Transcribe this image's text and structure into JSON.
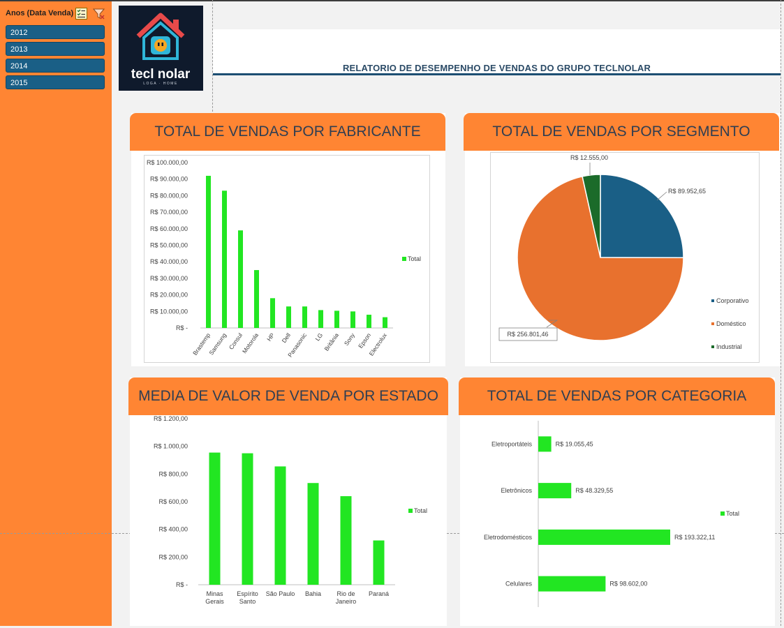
{
  "slicer": {
    "title": "Anos (Data Venda)",
    "items": [
      "2012",
      "2013",
      "2014",
      "2015"
    ]
  },
  "logo": {
    "brand": "tecl nolar",
    "tagline": "LOGA · HOME"
  },
  "report_title": "RELATORIO DE DESEMPENHO DE VENDAS DO GRUPO TECLNOLAR",
  "colors": {
    "accent": "#ff8533",
    "bar": "#22e622",
    "navy": "#1a5f86",
    "orange_slice": "#e8712e",
    "green_slice": "#1b6b2a"
  },
  "panels": {
    "fabricante": {
      "title": "TOTAL DE VENDAS POR FABRICANTE"
    },
    "segmento": {
      "title": "TOTAL DE VENDAS POR SEGMENTO"
    },
    "estado": {
      "title": "MEDIA DE VALOR DE VENDA POR ESTADO"
    },
    "categoria": {
      "title": "TOTAL DE VENDAS POR CATEGORIA"
    }
  },
  "chart_data": [
    {
      "id": "fabricante",
      "type": "bar",
      "categories": [
        "Brastemp",
        "Samsung",
        "Consul",
        "Motorola",
        "HP",
        "Dell",
        "Panasonic",
        "LG",
        "Britânia",
        "Sony",
        "Epson",
        "Electrolux"
      ],
      "series": [
        {
          "name": "Total",
          "values": [
            92000,
            83000,
            59000,
            35000,
            18000,
            13000,
            13000,
            10800,
            10400,
            10000,
            8000,
            6500
          ]
        }
      ],
      "ylim": [
        0,
        100000
      ],
      "yticks": [
        0,
        10000,
        20000,
        30000,
        40000,
        50000,
        60000,
        70000,
        80000,
        90000,
        100000
      ],
      "ytick_labels": [
        "R$ -",
        "R$ 10.000,00",
        "R$ 20.000,00",
        "R$ 30.000,00",
        "R$ 40.000,00",
        "R$ 50.000,00",
        "R$ 60.000,00",
        "R$ 70.000,00",
        "R$ 80.000,00",
        "R$ 90.000,00",
        "R$ 100.000,00"
      ],
      "legend": "right"
    },
    {
      "id": "segmento",
      "type": "pie",
      "categories": [
        "Corporativo",
        "Doméstico",
        "Industrial"
      ],
      "values": [
        89952.65,
        256801.46,
        12555.0
      ],
      "labels": [
        "R$ 89.952,65",
        "R$ 256.801,46",
        "R$ 12.555,00"
      ],
      "colors": [
        "#1a5f86",
        "#e8712e",
        "#1b6b2a"
      ],
      "legend": "bottom-right"
    },
    {
      "id": "estado",
      "type": "bar",
      "categories": [
        [
          "Minas",
          "Gerais"
        ],
        [
          "Espírito",
          "Santo"
        ],
        [
          "São Paulo"
        ],
        [
          "Bahia"
        ],
        [
          "Rio de",
          "Janeiro"
        ],
        [
          "Paraná"
        ]
      ],
      "series": [
        {
          "name": "Total",
          "values": [
            955,
            950,
            855,
            735,
            640,
            320
          ]
        }
      ],
      "ylim": [
        0,
        1200
      ],
      "yticks": [
        0,
        200,
        400,
        600,
        800,
        1000,
        1200
      ],
      "ytick_labels": [
        "R$ -",
        "R$ 200,00",
        "R$ 400,00",
        "R$ 600,00",
        "R$ 800,00",
        "R$ 1.000,00",
        "R$ 1.200,00"
      ],
      "legend": "right"
    },
    {
      "id": "categoria",
      "type": "bar",
      "orientation": "horizontal",
      "categories": [
        "Eletroportáteis",
        "Eletrônicos",
        "Eletrodomésticos",
        "Celulares"
      ],
      "series": [
        {
          "name": "Total",
          "values": [
            19055.45,
            48329.55,
            193322.11,
            98602.0
          ]
        }
      ],
      "data_labels": [
        "R$ 19.055,45",
        "R$ 48.329,55",
        "R$ 193.322,11",
        "R$ 98.602,00"
      ],
      "legend": "right"
    }
  ]
}
